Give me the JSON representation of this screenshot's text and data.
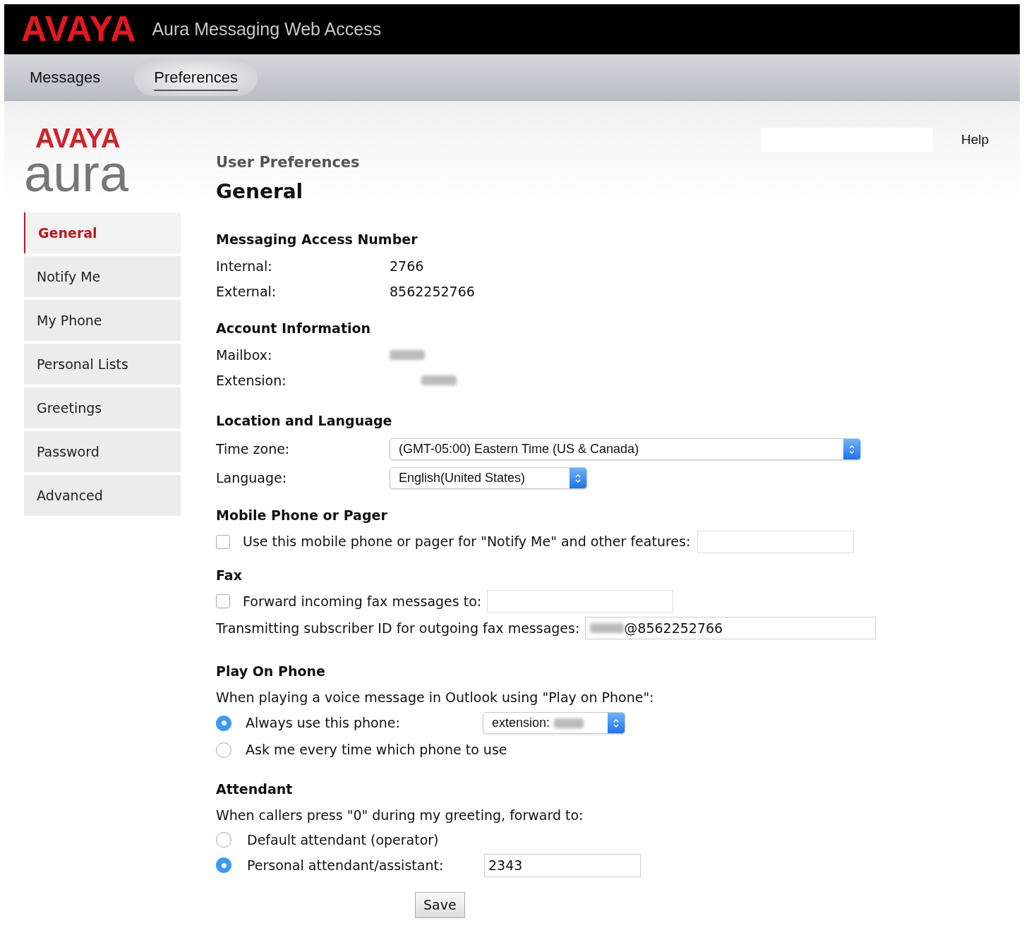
{
  "header": {
    "logo": "AVAYA",
    "title": "Aura Messaging Web Access"
  },
  "nav": [
    {
      "label": "Messages",
      "selected": false
    },
    {
      "label": "Preferences",
      "selected": true
    }
  ],
  "brand": {
    "top": "AVAYA",
    "bottom": "aura"
  },
  "help": "Help",
  "sidebar": [
    {
      "label": "General",
      "selected": true
    },
    {
      "label": "Notify Me",
      "selected": false
    },
    {
      "label": "My Phone",
      "selected": false
    },
    {
      "label": "Personal Lists",
      "selected": false
    },
    {
      "label": "Greetings",
      "selected": false
    },
    {
      "label": "Password",
      "selected": false
    },
    {
      "label": "Advanced",
      "selected": false
    }
  ],
  "page": {
    "supertitle": "User Preferences",
    "title": "General"
  },
  "access": {
    "heading": "Messaging Access Number",
    "rows": [
      {
        "label": "Internal:",
        "value": "2766"
      },
      {
        "label": "External:",
        "value": "8562252766"
      }
    ]
  },
  "account": {
    "heading": "Account Information",
    "rows": [
      {
        "label": "Mailbox:"
      },
      {
        "label": "Extension:"
      }
    ]
  },
  "location": {
    "heading": "Location and Language",
    "timezone": {
      "label": "Time zone:",
      "value": "(GMT-05:00) Eastern Time (US & Canada)"
    },
    "language": {
      "label": "Language:",
      "value": "English(United States)"
    }
  },
  "mobile": {
    "heading": "Mobile Phone or Pager",
    "label": "Use this mobile phone or pager for \"Notify Me\" and other features:",
    "checked": false
  },
  "fax": {
    "heading": "Fax",
    "label": "Forward incoming fax messages to:",
    "checked": false,
    "tsid_label": "Transmitting subscriber ID for outgoing fax messages:",
    "tsid_value": "@8562252766"
  },
  "play": {
    "heading": "Play On Phone",
    "intro": "When playing a voice message in Outlook using \"Play on Phone\":",
    "options": [
      {
        "label": "Always use this phone:",
        "selected": true,
        "kind": "select",
        "select_value": "extension:"
      },
      {
        "label": "Ask me every time which phone to use",
        "selected": false,
        "kind": "plain"
      }
    ]
  },
  "attendant": {
    "heading": "Attendant",
    "intro": "When callers press \"0\" during my greeting, forward to:",
    "options": [
      {
        "label": "Default attendant (operator)",
        "selected": false,
        "kind": "plain"
      },
      {
        "label": "Personal attendant/assistant:",
        "selected": true,
        "kind": "field",
        "value": "2343"
      }
    ]
  },
  "save": "Save"
}
